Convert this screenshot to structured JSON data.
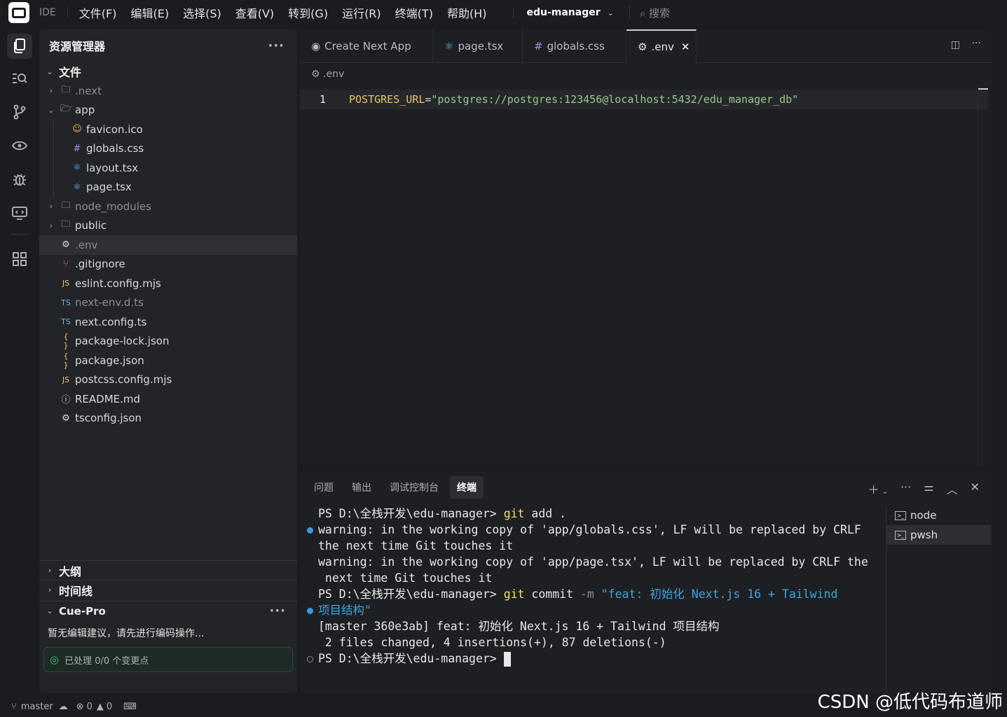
{
  "title_bar": {
    "ide_label": "IDE",
    "menu": [
      "文件(F)",
      "编辑(E)",
      "选择(S)",
      "查看(V)",
      "转到(G)",
      "运行(R)",
      "终端(T)",
      "帮助(H)"
    ],
    "project": "edu-manager",
    "search_placeholder": "搜索"
  },
  "explorer": {
    "title": "资源管理器",
    "section": "文件",
    "items": [
      {
        "label": ".next",
        "type": "folder",
        "open": false
      },
      {
        "label": "app",
        "type": "folder",
        "open": true
      },
      {
        "label": "favicon.ico",
        "type": "file",
        "icon": "face-icon"
      },
      {
        "label": "globals.css",
        "type": "file",
        "icon": "hash-icon"
      },
      {
        "label": "layout.tsx",
        "type": "file",
        "icon": "react-icon"
      },
      {
        "label": "page.tsx",
        "type": "file",
        "icon": "react-icon"
      },
      {
        "label": "node_modules",
        "type": "folder",
        "open": false
      },
      {
        "label": "public",
        "type": "folder",
        "open": false
      },
      {
        "label": ".env",
        "type": "file",
        "icon": "gear-icon",
        "selected": true
      },
      {
        "label": ".gitignore",
        "type": "file",
        "icon": "git-icon"
      },
      {
        "label": "eslint.config.mjs",
        "type": "file",
        "icon": "js-icon",
        "badge": "JS"
      },
      {
        "label": "next-env.d.ts",
        "type": "file",
        "icon": "ts-icon",
        "badge": "TS"
      },
      {
        "label": "next.config.ts",
        "type": "file",
        "icon": "ts-icon",
        "badge": "TS"
      },
      {
        "label": "package-lock.json",
        "type": "file",
        "icon": "json-icon",
        "badge": "{ }"
      },
      {
        "label": "package.json",
        "type": "file",
        "icon": "json-icon",
        "badge": "{ }"
      },
      {
        "label": "postcss.config.mjs",
        "type": "file",
        "icon": "js-icon",
        "badge": "JS"
      },
      {
        "label": "README.md",
        "type": "file",
        "icon": "info-icon"
      },
      {
        "label": "tsconfig.json",
        "type": "file",
        "icon": "gear-icon"
      }
    ],
    "outline": "大纲",
    "timeline": "时间线",
    "cue_title": "Cue-Pro",
    "cue_message": "暂无编辑建议，请先进行编码操作...",
    "cue_status": "已处理 0/0 个变更点"
  },
  "editor": {
    "tabs": [
      {
        "label": "Create Next App",
        "icon": "eye-icon"
      },
      {
        "label": "page.tsx",
        "icon": "react-icon"
      },
      {
        "label": "globals.css",
        "icon": "hash-icon"
      },
      {
        "label": ".env",
        "icon": "gear-icon",
        "active": true
      }
    ],
    "breadcrumb": ".env",
    "line_number": "1",
    "code_key": "POSTGRES_URL",
    "code_eq": "=",
    "code_value": "\"postgres://postgres:123456@localhost:5432/edu_manager_db\""
  },
  "panel": {
    "tabs": [
      "问题",
      "输出",
      "调试控制台",
      "终端"
    ],
    "active_tab": "终端",
    "terminal": {
      "l1_prompt": "PS D:\\全栈开发\\edu-manager> ",
      "l1_cmd": "git",
      "l1_rest": " add .",
      "l2": "warning: in the working copy of 'app/globals.css', LF will be replaced by CRLF",
      "l3": "the next time Git touches it",
      "l4": "warning: in the working copy of 'app/page.tsx', LF will be replaced by CRLF the",
      "l5": " next time Git touches it",
      "l6_prompt": "PS D:\\全栈开发\\edu-manager> ",
      "l6_cmd": "git",
      "l6_sub": " commit ",
      "l6_flag": "-m",
      "l6_str": " \"feat: 初始化 Next.js 16 + Tailwind",
      "l7_str": "项目结构\"",
      "l8": "[master 360e3ab] feat: 初始化 Next.js 16 + Tailwind 项目结构",
      "l9": " 2 files changed, 4 insertions(+), 87 deletions(-)",
      "l10_prompt": "PS D:\\全栈开发\\edu-manager> "
    },
    "terminals": [
      "node",
      "pwsh"
    ]
  },
  "status_bar": {
    "branch": "master",
    "errors": "0",
    "warnings": "0"
  },
  "watermark": "CSDN @低代码布道师"
}
